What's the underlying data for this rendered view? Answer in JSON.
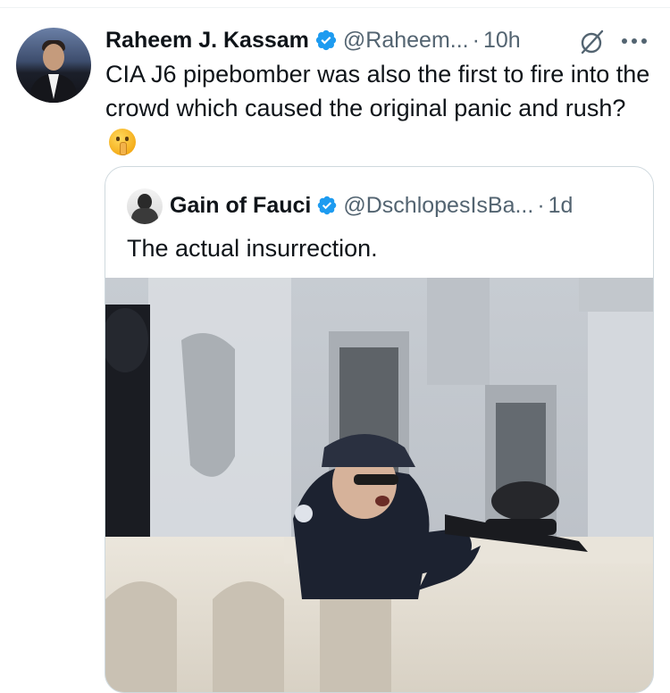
{
  "tweet": {
    "author": {
      "name": "Raheem J. Kassam",
      "handle": "@Raheem...",
      "verified": true
    },
    "separator": "·",
    "time": "10h",
    "text": "CIA J6 pipebomber was also the first to fire into the crowd which caused the original panic and rush?",
    "emoji": "shushing-face-emoji"
  },
  "quoted_tweet": {
    "author": {
      "name": "Gain of Fauci",
      "handle": "@DschlopesIsBa...",
      "verified": true
    },
    "separator": "·",
    "time": "1d",
    "text": "The actual insurrection.",
    "media": {
      "type": "image",
      "subject": "officer-aiming-paintball-gun"
    }
  },
  "icons": {
    "verified": "verified-badge-icon",
    "grok": "grok-icon",
    "more": "more-options-icon"
  },
  "colors": {
    "text_primary": "#0f1419",
    "text_secondary": "#536471",
    "verified_blue": "#1d9bf0",
    "border": "#cfd9de"
  }
}
